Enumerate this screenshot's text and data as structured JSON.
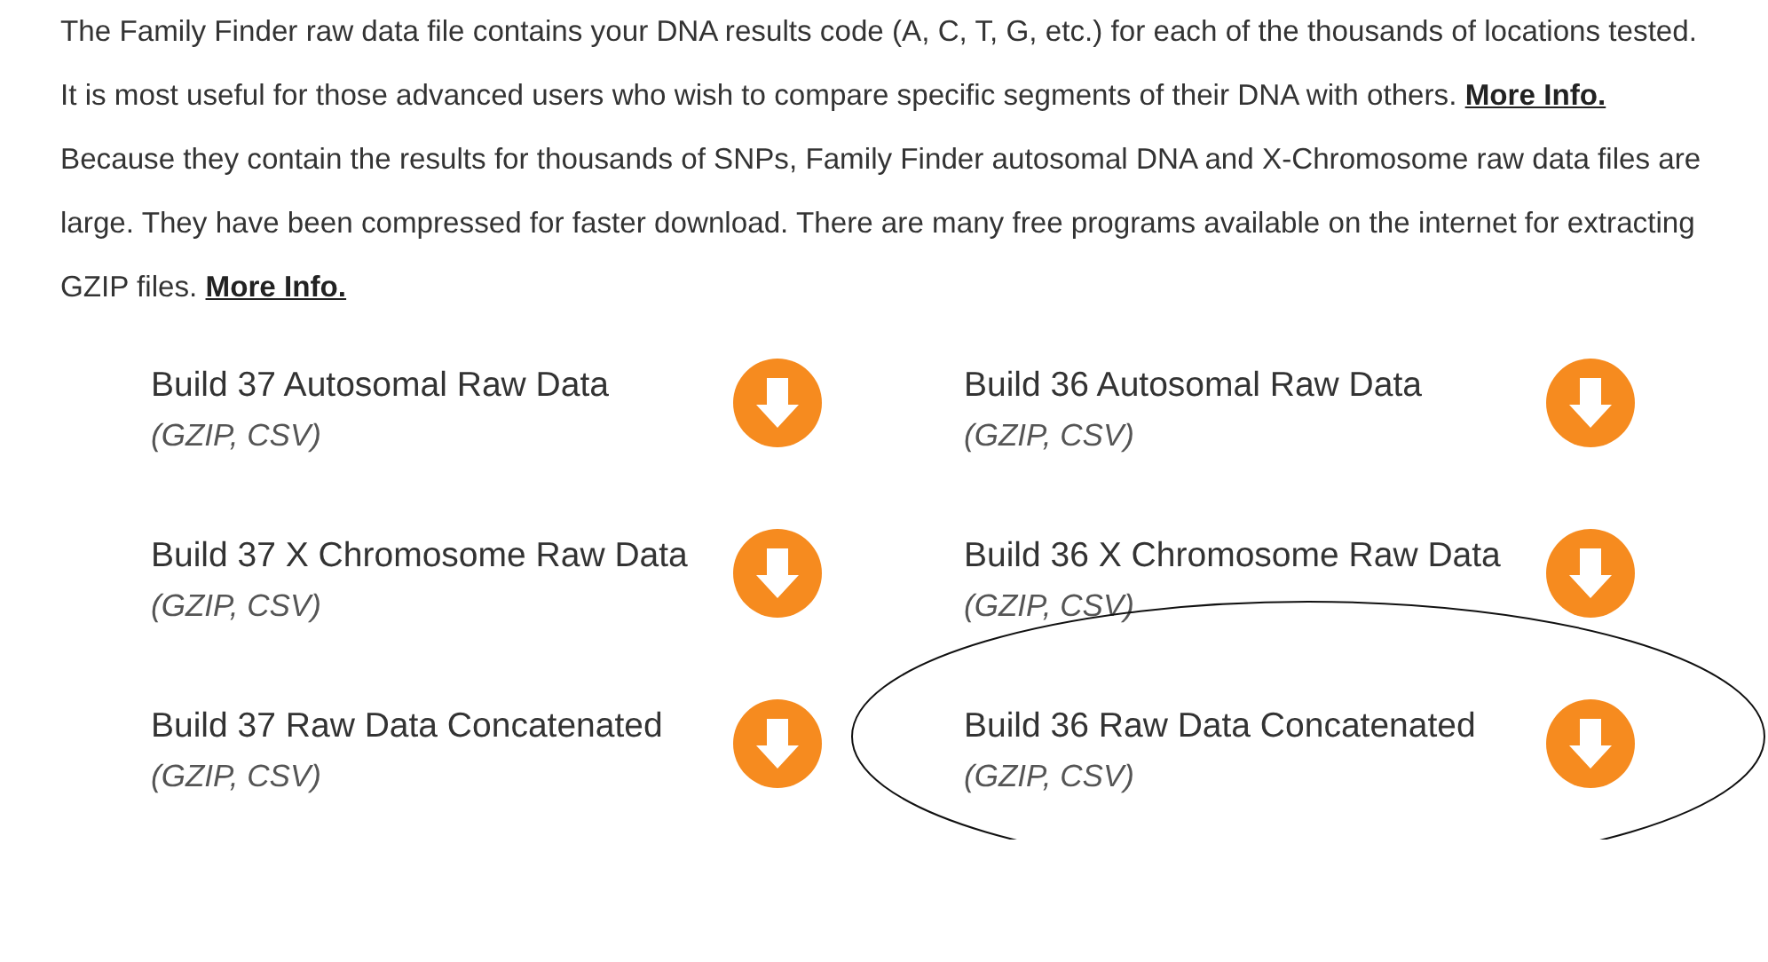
{
  "paragraphs": [
    {
      "text": "The Family Finder raw data file contains your DNA results code (A, C, T, G, etc.) for each of the thousands of locations tested. It is most useful for those advanced users who wish to compare specific segments of their DNA with others.",
      "link": "More Info."
    },
    {
      "text": "Because they contain the results for thousands of SNPs, Family Finder autosomal DNA and X-Chromosome raw data files are large. They have been compressed for faster download. There are many free programs available on the internet for extracting GZIP files.",
      "link": "More Info."
    }
  ],
  "downloads": [
    {
      "title": "Build 37 Autosomal Raw Data",
      "format": "(GZIP, CSV)",
      "highlighted": false
    },
    {
      "title": "Build 36 Autosomal Raw Data",
      "format": "(GZIP, CSV)",
      "highlighted": false
    },
    {
      "title": "Build 37 X Chromosome Raw Data",
      "format": "(GZIP, CSV)",
      "highlighted": false
    },
    {
      "title": "Build 36 X Chromosome Raw Data",
      "format": "(GZIP, CSV)",
      "highlighted": false
    },
    {
      "title": "Build 37 Raw Data Concatenated",
      "format": "(GZIP, CSV)",
      "highlighted": false
    },
    {
      "title": "Build 36 Raw Data Concatenated",
      "format": "(GZIP, CSV)",
      "highlighted": true
    }
  ]
}
